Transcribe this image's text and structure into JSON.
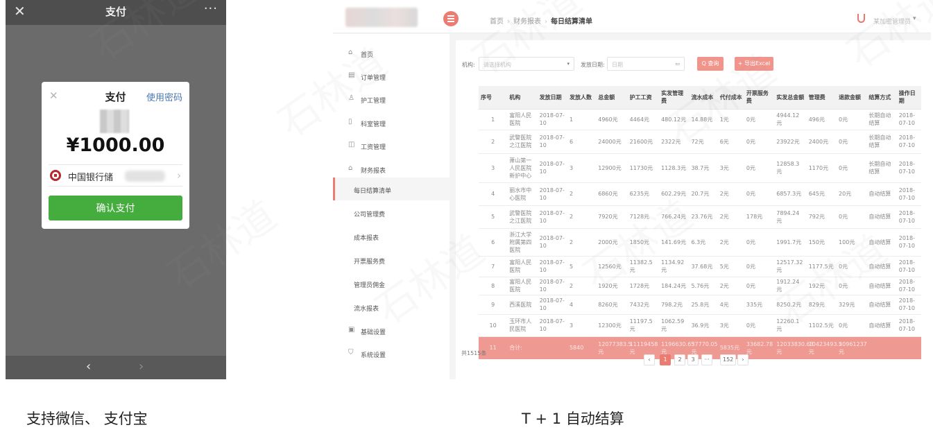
{
  "phone": {
    "title": "支付",
    "close_glyph": "✕",
    "more_glyph": "···",
    "back_glyph": "‹",
    "forward_glyph": "›",
    "dialog": {
      "close_glyph": "✕",
      "title": "支付",
      "use_password": "使用密码",
      "amount": "¥1000.00",
      "bank_name": "中国银行储",
      "chevron_glyph": "›",
      "confirm_label": "确认支付"
    }
  },
  "admin": {
    "breadcrumb": [
      "首页",
      "财务报表",
      "每日结算清单"
    ],
    "breadcrumb_sep": "›",
    "user_name": "某加密管理员",
    "user_caret": "▾",
    "sidebar": [
      {
        "label": "首页",
        "icon": "home-icon",
        "glyph": "⌂"
      },
      {
        "label": "订单管理",
        "icon": "order-icon",
        "glyph": "▤"
      },
      {
        "label": "护工管理",
        "icon": "person-icon",
        "glyph": "♙"
      },
      {
        "label": "科室管理",
        "icon": "building-icon",
        "glyph": "▯"
      },
      {
        "label": "工资管理",
        "icon": "wallet-icon",
        "glyph": "◫"
      },
      {
        "label": "财务报表",
        "icon": "report-icon",
        "glyph": "⌂"
      },
      {
        "label": "每日结算清单",
        "icon": "",
        "glyph": ""
      },
      {
        "label": "公司管理费",
        "icon": "",
        "glyph": ""
      },
      {
        "label": "成本报表",
        "icon": "",
        "glyph": ""
      },
      {
        "label": "开票服务费",
        "icon": "",
        "glyph": ""
      },
      {
        "label": "管理员佣金",
        "icon": "",
        "glyph": ""
      },
      {
        "label": "流水报表",
        "icon": "",
        "glyph": ""
      },
      {
        "label": "基础设置",
        "icon": "settings-icon",
        "glyph": "▣"
      },
      {
        "label": "系统设置",
        "icon": "shield-icon",
        "glyph": "⛉"
      }
    ],
    "filters": {
      "org_label": "机构:",
      "org_placeholder": "请选择机构",
      "org_caret": "▾",
      "date_label": "发放日期:",
      "date_placeholder": "日期",
      "date_icon_glyph": "▭",
      "query_label": "Q 查询",
      "export_label": "+ 导出Excel"
    },
    "table": {
      "columns": [
        "序号",
        "机构",
        "发放日期",
        "发放人数",
        "总金额",
        "护工工资",
        "实发管理费",
        "流水成本",
        "代付成本",
        "开票服务费",
        "实发总金额",
        "管理费",
        "退款金额",
        "结算方式",
        "操作日期"
      ],
      "rows": [
        [
          "1",
          "富阳人民医院",
          "2018-07-10",
          "1",
          "4960元",
          "4464元",
          "480.12元",
          "14.88元",
          "1元",
          "0元",
          "4944.12元",
          "496元",
          "0元",
          "长期自动结算",
          "2018-07-10"
        ],
        [
          "2",
          "武警医院之江医院",
          "2018-07-10",
          "6",
          "24000元",
          "21600元",
          "2322元",
          "72元",
          "6元",
          "0元",
          "23922元",
          "2400元",
          "0元",
          "长期自动结算",
          "2018-07-10"
        ],
        [
          "3",
          "萧山第一人民医院新护中心",
          "2018-07-10",
          "3",
          "12900元",
          "11730元",
          "1128.3元",
          "38.7元",
          "3元",
          "0元",
          "12858.3元",
          "1170元",
          "0元",
          "长期自动结算",
          "2018-07-10"
        ],
        [
          "4",
          "丽水市中心医院",
          "2018-07-10",
          "2",
          "6860元",
          "6235元",
          "602.29元",
          "20.7元",
          "2元",
          "0元",
          "6857.3元",
          "645元",
          "20元",
          "自动结算",
          "2018-07-10"
        ],
        [
          "5",
          "武警医院之江医院",
          "2018-07-10",
          "2",
          "7920元",
          "7128元",
          "766.24元",
          "23.76元",
          "2元",
          "178元",
          "7894.24元",
          "792元",
          "0元",
          "自动结算",
          "2018-07-10"
        ],
        [
          "6",
          "浙江大学附属第四医院",
          "2018-07-10",
          "2",
          "2000元",
          "1850元",
          "141.69元",
          "6.3元",
          "2元",
          "0元",
          "1991.7元",
          "150元",
          "100元",
          "自动结算",
          "2018-07-10"
        ],
        [
          "7",
          "富阳人民医院",
          "2018-07-10",
          "5",
          "12560元",
          "11382.5元",
          "1134.92元",
          "37.68元",
          "5元",
          "0元",
          "12517.32元",
          "1177.5元",
          "0元",
          "自动结算",
          "2018-07-10"
        ],
        [
          "8",
          "富阳人民医院",
          "2018-07-10",
          "2",
          "1920元",
          "1728元",
          "184.24元",
          "5.76元",
          "2元",
          "0元",
          "1912.24元",
          "192元",
          "0元",
          "自动结算",
          "2018-07-10"
        ],
        [
          "9",
          "西溪医院",
          "2018-07-10",
          "4",
          "8260元",
          "7432元",
          "798.2元",
          "25.8元",
          "4元",
          "335元",
          "8250.2元",
          "829元",
          "329元",
          "自动结算",
          "2018-07-10"
        ],
        [
          "10",
          "玉环市人民医院",
          "2018-07-10",
          "3",
          "12300元",
          "11197.5元",
          "1062.59元",
          "36.9元",
          "3元",
          "0元",
          "12260.1元",
          "1102.5元",
          "0元",
          "自动结算",
          "2018-07-10"
        ]
      ],
      "total_row": [
        "11",
        "合计:",
        "",
        "5840",
        "12077383.5元",
        "11119458元",
        "1196630.65元",
        "37770.05元",
        "5835元",
        "33682.78元",
        "12033830.63元",
        "10423493.5元",
        "20961237元",
        "",
        ""
      ]
    },
    "pager": {
      "total": "共1515条",
      "prev": "‹",
      "pages": [
        "1",
        "2",
        "3",
        "···",
        "152"
      ],
      "next": "›"
    }
  },
  "captions": {
    "left": "支持微信、 支付宝",
    "right": "T + 1 自动结算"
  },
  "watermark": {
    "text": "石林道"
  },
  "colors": {
    "accent": "#ec7b72",
    "confirm_green": "#44ad3d",
    "total_row": "#ee9991",
    "bank_red": "#b7282e"
  }
}
